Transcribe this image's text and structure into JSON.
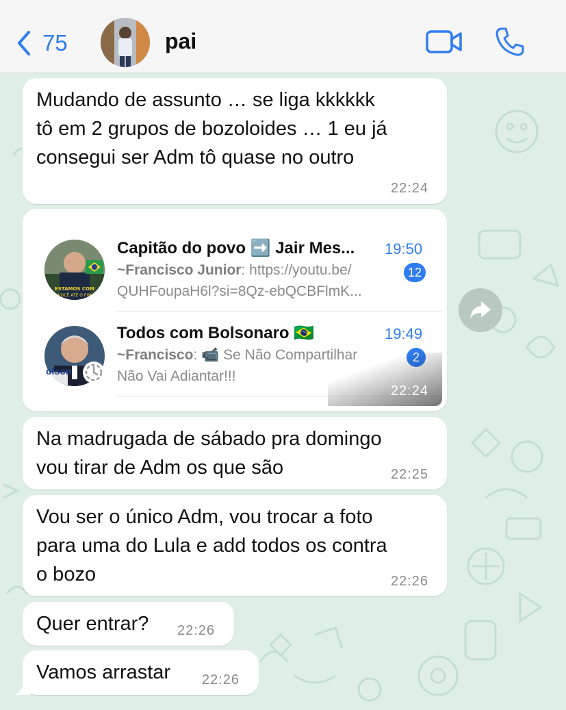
{
  "header": {
    "back_count": "75",
    "contact_name": "pai"
  },
  "messages": [
    {
      "text": "Mudando de assunto … se liga kkkkkk\ntô em 2 grupos de bozoloides … 1 eu já\nconsegui ser Adm tô quase no outro",
      "time": "22:24"
    },
    {
      "text": "Na madrugada de sábado pra domingo\nvou tirar de Adm os que são",
      "time": "22:25"
    },
    {
      "text": "Vou ser o único Adm, vou trocar a foto\npara uma do Lula e add todos os contra\no bozo",
      "time": "22:26"
    },
    {
      "text": "Quer entrar?",
      "time": "22:26"
    },
    {
      "text": "Vamos arrastar",
      "time": "22:26"
    }
  ],
  "image_message": {
    "time": "22:24",
    "chats": [
      {
        "title": "Capitão do povo ➡️ Jair Mes...",
        "time": "19:50",
        "sender": "~Francisco Junior",
        "preview_1": ": https://youtu.be/",
        "preview_2": "QUHFoupaH6l?si=8Qz-ebQCBFlmK...",
        "unread": "12",
        "avatar_text": "ESTAMOS COM\nVOCÊ ATÉ O FIM"
      },
      {
        "title": "Todos com Bolsonaro 🇧🇷",
        "time": "19:49",
        "sender": "~Francisco",
        "preview_1": ": 📹 Se Não Compartilhar",
        "preview_2": "Não Vai Adiantar!!!",
        "unread": "2",
        "avatar_text": "olson"
      }
    ]
  },
  "colors": {
    "accent": "#2f7cf0",
    "bubble": "#ffffff",
    "wallpaper": "#dfeee6"
  }
}
